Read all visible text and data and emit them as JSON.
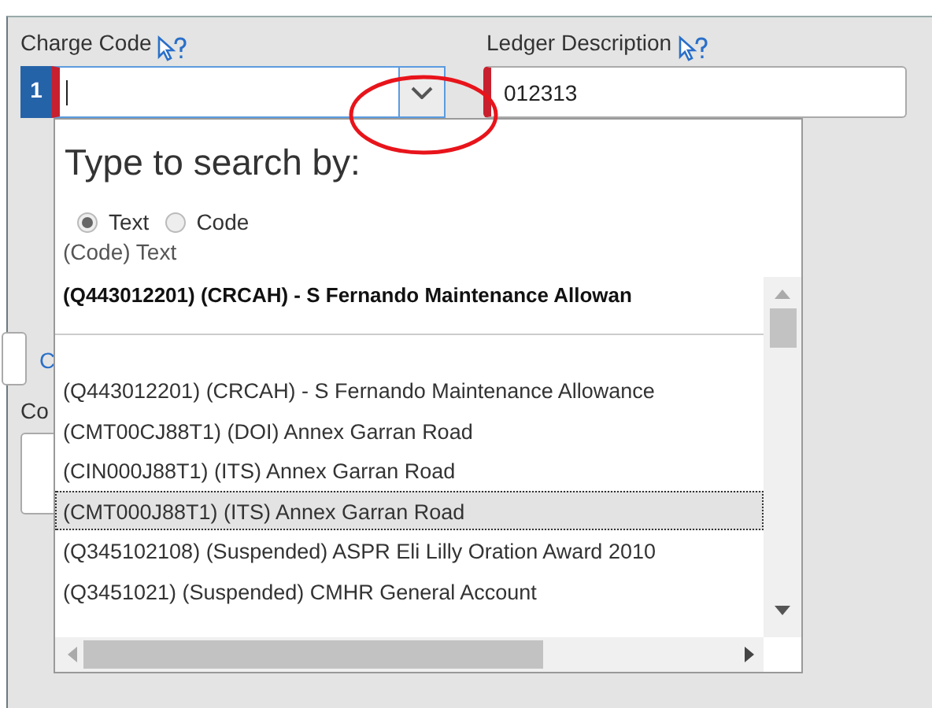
{
  "charge_code": {
    "label": "Charge Code",
    "line_number": "1",
    "required": true,
    "focused": true
  },
  "ledger_description": {
    "label": "Ledger Description",
    "required": true,
    "value": "012313"
  },
  "background": {
    "link_fragment": "C",
    "label_fragment": "Co"
  },
  "dropdown": {
    "heading": "Type to search by:",
    "search_modes": [
      {
        "label": "Text",
        "selected": true
      },
      {
        "label": "Code",
        "selected": false
      }
    ],
    "format_hint": "(Code) Text",
    "options": [
      {
        "kind": "current",
        "text": "(Q443012201) (CRCAH) - S Fernando Maintenance Allowan",
        "selected": false
      },
      {
        "kind": "separator"
      },
      {
        "kind": "blank"
      },
      {
        "kind": "option",
        "text": "(Q443012201) (CRCAH) - S Fernando Maintenance Allowance",
        "selected": false
      },
      {
        "kind": "option",
        "text": "(CMT00CJ88T1) (DOI) Annex Garran Road",
        "selected": false
      },
      {
        "kind": "option",
        "text": "(CIN000J88T1) (ITS) Annex Garran Road",
        "selected": false
      },
      {
        "kind": "option",
        "text": "(CMT000J88T1) (ITS) Annex Garran Road",
        "selected": true
      },
      {
        "kind": "option",
        "text": "(Q345102108) (Suspended) ASPR Eli Lilly Oration Award 2010",
        "selected": false
      },
      {
        "kind": "option",
        "text": "(Q3451021) (Suspended) CMHR General Account",
        "selected": false
      }
    ]
  },
  "annotation": {
    "kind": "ellipse",
    "color": "#e8141b"
  }
}
